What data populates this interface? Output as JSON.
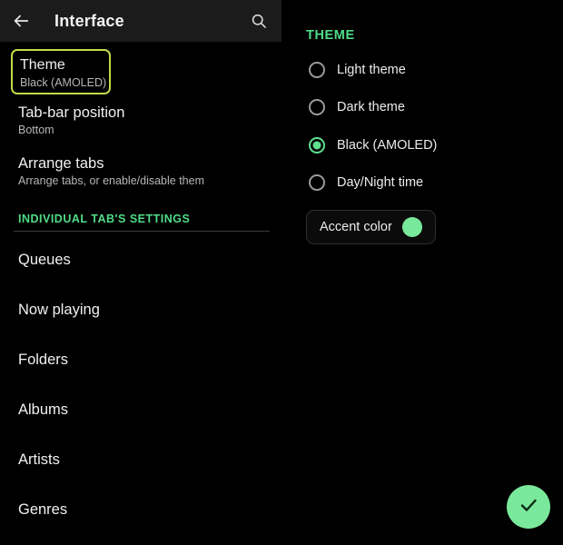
{
  "appbar": {
    "back_icon": "arrow-left-icon",
    "title": "Interface",
    "search_icon": "search-icon"
  },
  "left_pane": {
    "preferences": [
      {
        "title": "Theme",
        "subtitle": "Black (AMOLED)",
        "highlighted": true
      },
      {
        "title": "Tab-bar position",
        "subtitle": "Bottom",
        "highlighted": false
      },
      {
        "title": "Arrange tabs",
        "subtitle": "Arrange tabs, or enable/disable them",
        "highlighted": false
      }
    ],
    "section_header": "INDIVIDUAL TAB'S SETTINGS",
    "tabs": [
      {
        "label": "Queues"
      },
      {
        "label": "Now playing"
      },
      {
        "label": "Folders"
      },
      {
        "label": "Albums"
      },
      {
        "label": "Artists"
      },
      {
        "label": "Genres"
      }
    ]
  },
  "right_pane": {
    "header": "THEME",
    "options": [
      {
        "label": "Light theme",
        "selected": false
      },
      {
        "label": "Dark theme",
        "selected": false
      },
      {
        "label": "Black (AMOLED)",
        "selected": true
      },
      {
        "label": "Day/Night time",
        "selected": false
      }
    ],
    "accent": {
      "label": "Accent color",
      "swatch_color": "#78e89a"
    }
  },
  "fab": {
    "icon": "check-icon",
    "color": "#7ae89b"
  },
  "colors": {
    "accent_green": "#4fdc87",
    "highlight_border": "#c3d94a",
    "appbar_background": "#1b1b1b",
    "page_background": "#000000"
  }
}
